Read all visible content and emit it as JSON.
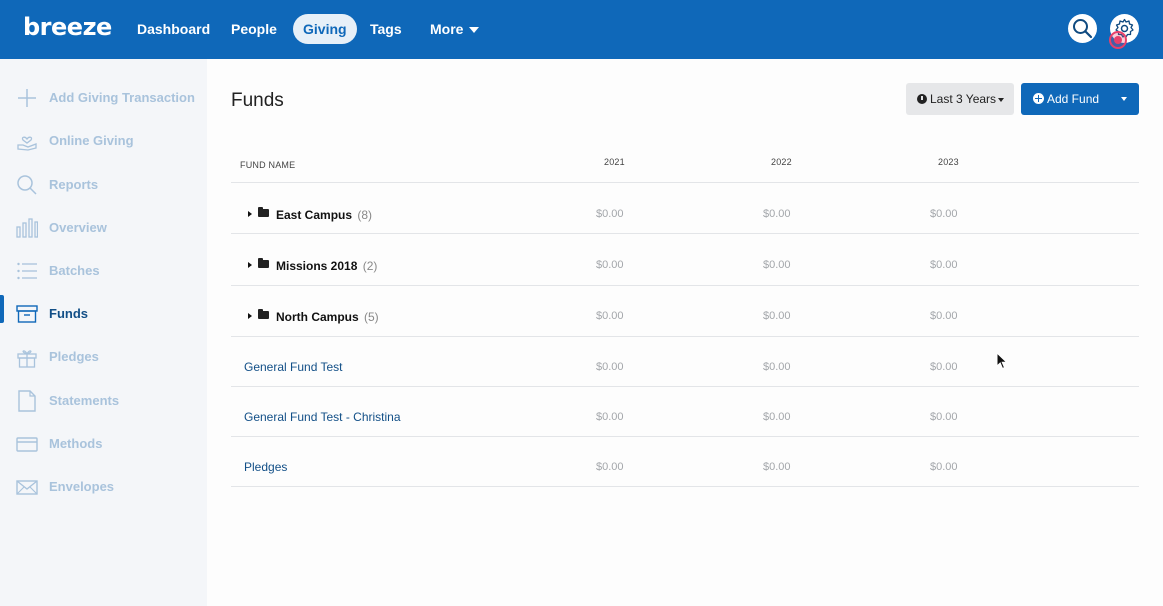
{
  "app": {
    "logo": "breeze"
  },
  "nav": {
    "items": [
      {
        "label": "Dashboard"
      },
      {
        "label": "People"
      },
      {
        "label": "Giving",
        "active": true
      },
      {
        "label": "Tags"
      },
      {
        "label": "More"
      }
    ],
    "search_icon": "search-icon",
    "settings_icon": "gear-icon",
    "accent": "#0f68b9"
  },
  "sidebar": {
    "items": [
      {
        "label": "Add Giving Transaction",
        "icon": "plus-icon"
      },
      {
        "label": "Online Giving",
        "icon": "hand-heart-icon"
      },
      {
        "label": "Reports",
        "icon": "search-icon"
      },
      {
        "label": "Overview",
        "icon": "bar-chart-icon"
      },
      {
        "label": "Batches",
        "icon": "list-icon"
      },
      {
        "label": "Funds",
        "icon": "archive-box-icon",
        "active": true
      },
      {
        "label": "Pledges",
        "icon": "gift-icon"
      },
      {
        "label": "Statements",
        "icon": "document-icon"
      },
      {
        "label": "Methods",
        "icon": "credit-card-icon"
      },
      {
        "label": "Envelopes",
        "icon": "envelope-icon"
      }
    ]
  },
  "main": {
    "title": "Funds",
    "range_button": "Last 3 Years",
    "add_button": "Add Fund",
    "table": {
      "headers": [
        "FUND NAME",
        "2021",
        "2022",
        "2023"
      ],
      "rows": [
        {
          "name": "East Campus",
          "count": "(8)",
          "type": "folder",
          "values": [
            "$0.00",
            "$0.00",
            "$0.00"
          ]
        },
        {
          "name": "Missions 2018",
          "count": "(2)",
          "type": "folder",
          "values": [
            "$0.00",
            "$0.00",
            "$0.00"
          ]
        },
        {
          "name": "North Campus",
          "count": "(5)",
          "type": "folder",
          "values": [
            "$0.00",
            "$0.00",
            "$0.00"
          ]
        },
        {
          "name": "General Fund Test",
          "type": "link",
          "values": [
            "$0.00",
            "$0.00",
            "$0.00"
          ]
        },
        {
          "name": "General Fund Test - Christina",
          "type": "link",
          "values": [
            "$0.00",
            "$0.00",
            "$0.00"
          ]
        },
        {
          "name": "Pledges",
          "type": "link",
          "values": [
            "$0.00",
            "$0.00",
            "$0.00"
          ]
        }
      ]
    }
  }
}
